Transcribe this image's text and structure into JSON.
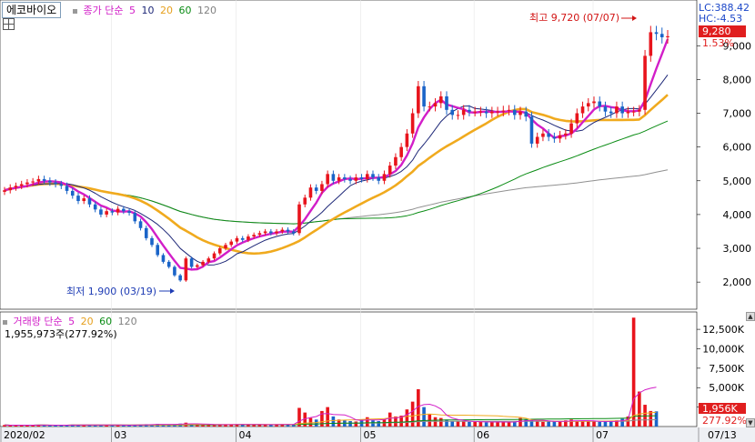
{
  "stock_name": "에코바이오",
  "price_legend": {
    "label": "종가 단순",
    "periods": [
      "5",
      "10",
      "20",
      "60",
      "120"
    ]
  },
  "volume_legend": {
    "label": "거래량 단순",
    "periods": [
      "5",
      "20",
      "60",
      "120"
    ],
    "current": "1,955,973주(277.92%)"
  },
  "axis_tags": {
    "lc": "LC:388.42",
    "hc": "HC:-4.53",
    "price": "9,280",
    "change": "1.53%",
    "volume": "1,956K",
    "volume_pct": "277.92%"
  },
  "annotations": {
    "high": "최고 9,720 (07/07)",
    "low": "최저 1,900 (03/19)"
  },
  "colors": {
    "up": "#e8141c",
    "down": "#1a64c8",
    "ma5": "#d21ec8",
    "ma10": "#1e2878",
    "ma20": "#f0aa1e",
    "ma60": "#0a8c14",
    "ma120": "#909090",
    "tag_red": "#e01e1e"
  },
  "chart_data": {
    "type": "candlestick",
    "date_range": [
      "2020-02",
      "2020-07"
    ],
    "x_tick_labels": [
      "2020/02",
      "03",
      "04",
      "05",
      "06",
      "07",
      "07/13"
    ],
    "price_axis": {
      "ticks": [
        2000,
        3000,
        4000,
        5000,
        6000,
        7000,
        8000,
        9000
      ],
      "tick_labels": [
        "2,000",
        "3,000",
        "4,000",
        "5,000",
        "6,000",
        "7,000",
        "8,000",
        "9,000"
      ],
      "ylim": [
        1250,
        10300
      ]
    },
    "volume_axis": {
      "ticks": [
        2500,
        5000,
        7500,
        10000,
        12500
      ],
      "tick_labels": [
        "2,500K",
        "5,000K",
        "7,500K",
        "10,000K",
        "12,500K"
      ],
      "ylim": [
        0,
        14500
      ]
    },
    "month_start_index": [
      0,
      19,
      41,
      63,
      83,
      104
    ],
    "close": [
      4720,
      4800,
      4850,
      4900,
      4950,
      4980,
      5050,
      5000,
      4950,
      4900,
      4850,
      4700,
      4560,
      4400,
      4480,
      4300,
      4150,
      4000,
      4100,
      4060,
      4170,
      4100,
      4050,
      3800,
      3600,
      3300,
      3100,
      2800,
      2600,
      2450,
      2200,
      2050,
      2700,
      2450,
      2500,
      2600,
      2700,
      2850,
      3000,
      3100,
      3200,
      3300,
      3250,
      3350,
      3400,
      3450,
      3500,
      3450,
      3500,
      3550,
      3500,
      3450,
      4300,
      4500,
      4800,
      4700,
      4900,
      5200,
      5000,
      5100,
      5050,
      5000,
      5100,
      5050,
      5200,
      5100,
      5000,
      5200,
      5450,
      5700,
      6000,
      6400,
      7000,
      7800,
      7200,
      7200,
      7300,
      7500,
      7100,
      6950,
      6950,
      7100,
      7050,
      7050,
      7050,
      7000,
      7050,
      7050,
      7080,
      7100,
      6950,
      7050,
      6900,
      6100,
      6300,
      6400,
      6300,
      6250,
      6350,
      6400,
      6700,
      7000,
      7200,
      7300,
      7350,
      7200,
      7050,
      7000,
      7200,
      7000,
      7050,
      7050,
      7100,
      8700,
      9400,
      9350,
      9250,
      9280
    ],
    "volume_k": [
      200,
      150,
      180,
      160,
      200,
      170,
      220,
      180,
      160,
      150,
      170,
      200,
      250,
      180,
      200,
      190,
      210,
      220,
      180,
      170,
      200,
      180,
      160,
      240,
      260,
      300,
      280,
      350,
      240,
      260,
      300,
      380,
      500,
      300,
      250,
      220,
      230,
      260,
      240,
      250,
      260,
      280,
      300,
      250,
      220,
      230,
      240,
      260,
      280,
      300,
      250,
      240,
      2400,
      1800,
      1100,
      900,
      2000,
      2500,
      1300,
      900,
      800,
      700,
      650,
      900,
      1200,
      800,
      700,
      900,
      1800,
      1300,
      1400,
      2200,
      3200,
      4800,
      2500,
      1600,
      1200,
      1100,
      900,
      700,
      650,
      650,
      600,
      600,
      600,
      550,
      600,
      550,
      600,
      560,
      600,
      1100,
      900,
      800,
      650,
      600,
      700,
      650,
      650,
      800,
      900,
      750,
      700,
      650,
      650,
      600,
      700,
      650,
      800,
      1000,
      1300,
      14000,
      4500,
      2800,
      2000,
      1956
    ]
  }
}
